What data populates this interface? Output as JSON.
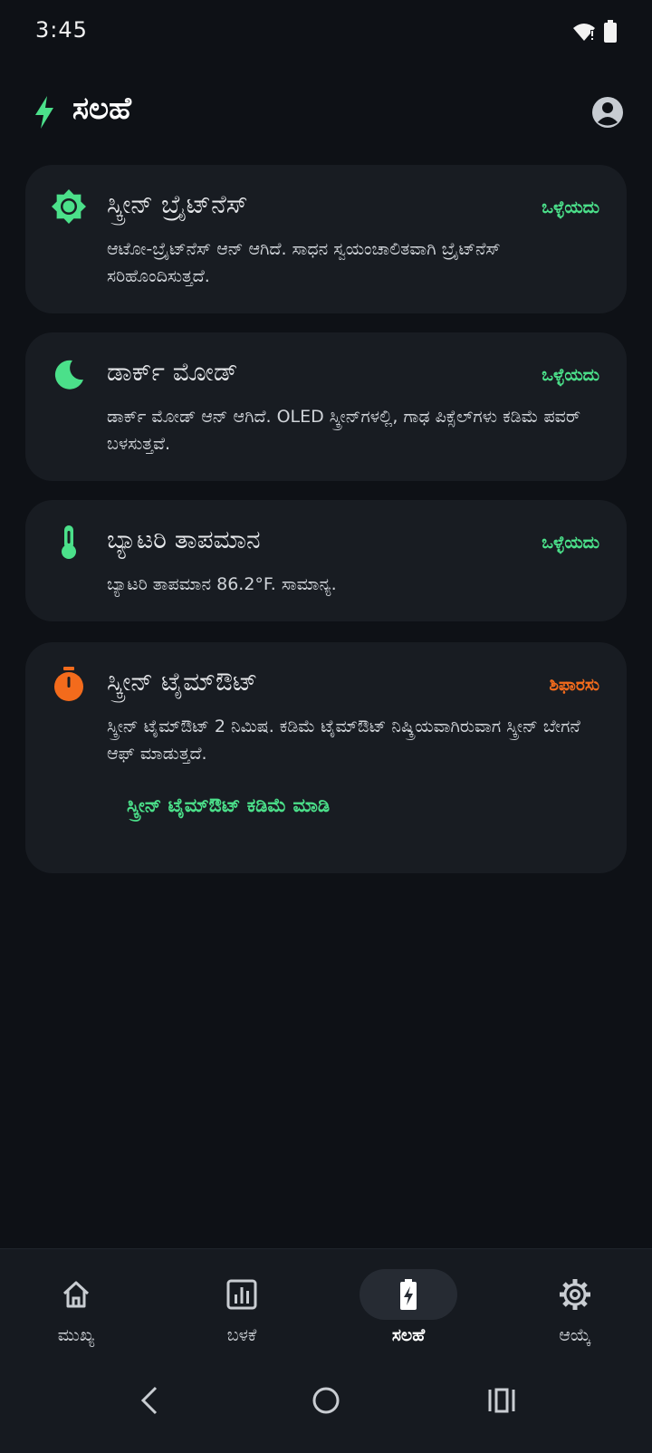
{
  "status_bar": {
    "time": "3:45"
  },
  "header": {
    "title": "ಸಲಹೆ"
  },
  "cards": [
    {
      "title": "ಸ್ಕ್ರೀನ್ ಬ್ರೈಟ್‌ನೆಸ್",
      "status": "ಒಳ್ಳೆಯದು",
      "description": "ಆಟೋ-ಬ್ರೈಟ್‌ನೆಸ್ ಆನ್ ಆಗಿದೆ. ಸಾಧನ ಸ್ವಯಂಚಾಲಿತವಾಗಿ ಬ್ರೈಟ್‌ನೆಸ್ ಸರಿಹೊಂದಿಸುತ್ತದೆ.",
      "icon": "brightness-icon"
    },
    {
      "title": "ಡಾರ್ಕ್ ಮೋಡ್",
      "status": "ಒಳ್ಳೆಯದು",
      "description": "ಡಾರ್ಕ್ ಮೋಡ್ ಆನ್ ಆಗಿದೆ. OLED ಸ್ಕ್ರೀನ್‌ಗಳಲ್ಲಿ, ಗಾಢ ಪಿಕ್ಸೆಲ್‌ಗಳು ಕಡಿಮೆ ಪವರ್ ಬಳಸುತ್ತವೆ.",
      "icon": "moon-icon"
    },
    {
      "title": "ಬ್ಯಾಟರಿ ತಾಪಮಾನ",
      "status": "ಒಳ್ಳೆಯದು",
      "description": "ಬ್ಯಾಟರಿ ತಾಪಮಾನ 86.2°F. ಸಾಮಾನ್ಯ.",
      "icon": "thermometer-icon"
    },
    {
      "title": "ಸ್ಕ್ರೀನ್ ಟೈಮ್‌ಔಟ್",
      "status": "ಶಿಫಾರಸು",
      "description": "ಸ್ಕ್ರೀನ್ ಟೈಮ್‌ಔಟ್ 2 ನಿಮಿಷ. ಕಡಿಮೆ ಟೈಮ್‌ಔಟ್ ನಿಷ್ಕ್ರಿಯವಾಗಿರುವಾಗ ಸ್ಕ್ರೀನ್ ಬೇಗನೆ ಆಫ್ ಮಾಡುತ್ತದೆ.",
      "action": "ಸ್ಕ್ರೀನ್ ಟೈಮ್‌ಔಟ್ ಕಡಿಮೆ ಮಾಡಿ",
      "icon": "timer-icon"
    }
  ],
  "bottom_nav": [
    {
      "label": "ಮುಖ್ಯ",
      "icon": "home-icon",
      "active": false
    },
    {
      "label": "ಬಳಕೆ",
      "icon": "chart-icon",
      "active": false
    },
    {
      "label": "ಸಲಹೆ",
      "icon": "battery-bolt-icon",
      "active": true
    },
    {
      "label": "ಆಯ್ಕೆ",
      "icon": "gear-icon",
      "active": false
    }
  ],
  "colors": {
    "background": "#0e1116",
    "card": "#181c22",
    "accent_green": "#4be08a",
    "warning_orange": "#f36b1c"
  }
}
